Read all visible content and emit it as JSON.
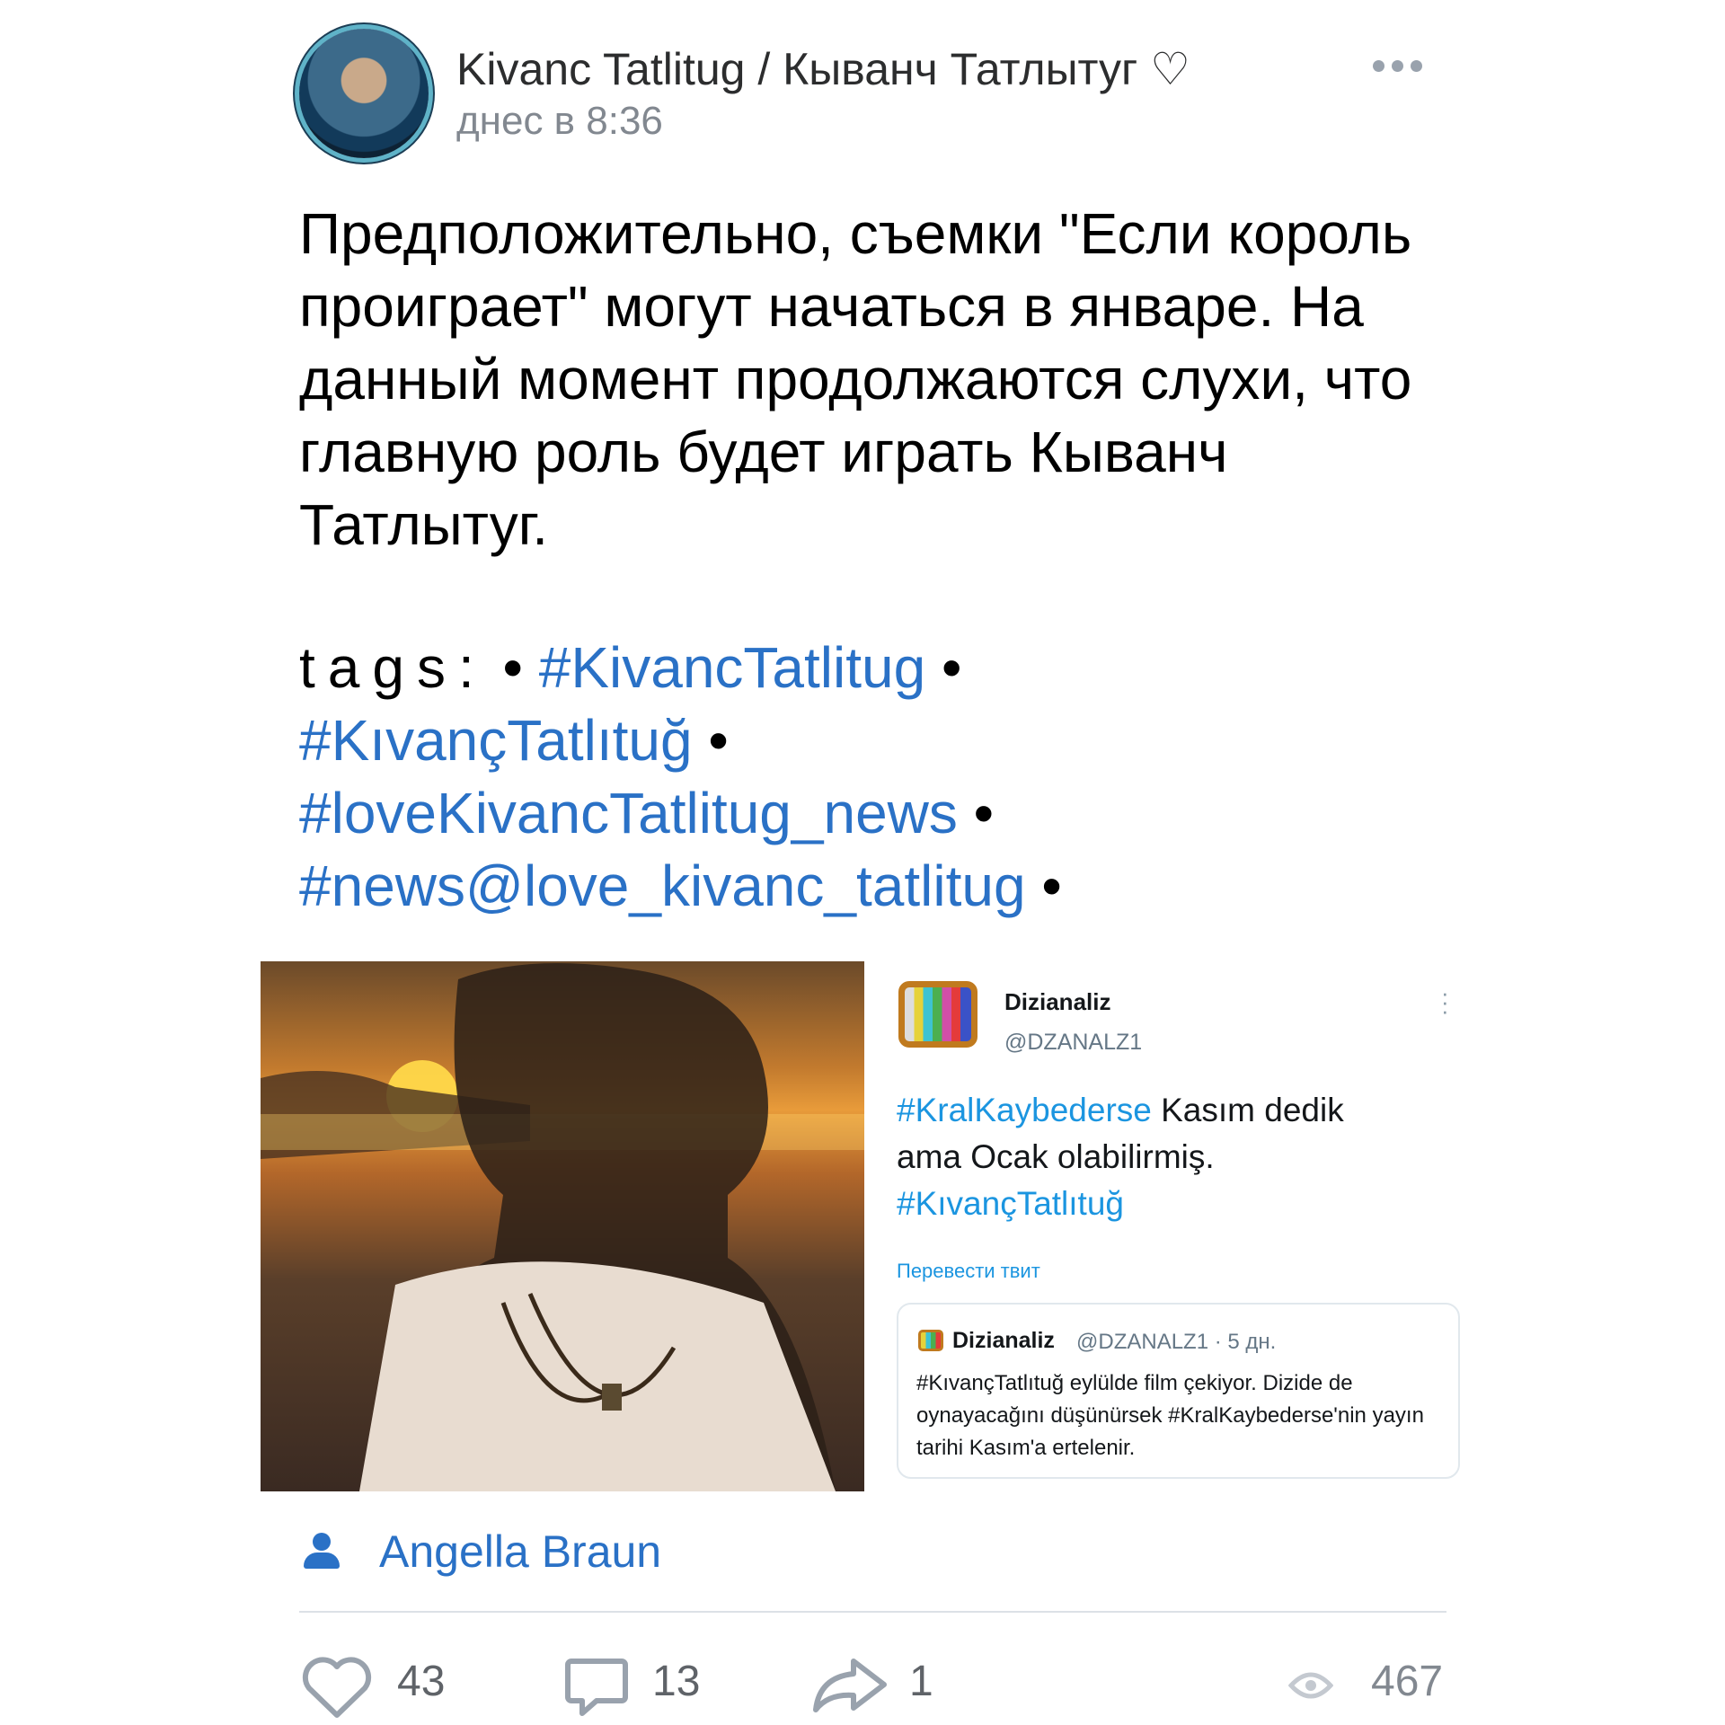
{
  "post": {
    "author": "Kivanc Tatlitug / Кыванч Татлытуг ♡",
    "time": "днес в 8:36",
    "text": "Предположительно, съемки \"Если король проиграет\" могут начаться в январе. На данный момент продолжаются слухи, что главную роль будет играть Кыванч Татлытуг.",
    "tags_label": "tags:",
    "tags": [
      "#KivancTatlitug",
      "#KıvançTatlıtuğ",
      "#loveKivancTatlitug_news",
      "#news@love_kivanc_tatlitug"
    ],
    "bullet": "•"
  },
  "tweet": {
    "name": "Dizianaliz",
    "handle": "@DZANALZ1",
    "hashtag1": "#KralKaybederse",
    "text_mid": " Kasım dedik ama Ocak olabilirmiş.",
    "hashtag2": "#KıvançTatlıtuğ",
    "translate": "Перевести твит",
    "quote": {
      "name": "Dizianaliz",
      "meta": "@DZANALZ1 · 5 дн.",
      "text": "#KıvançTatlıtuğ eylülde film çekiyor. Dizide de oynayacağını düşünürsek #KralKaybederse'nin yayın tarihi Kasım'a ertelenir."
    }
  },
  "credit": {
    "name": "Angella Braun"
  },
  "footer": {
    "likes": "43",
    "comments": "13",
    "shares": "1",
    "views": "467"
  },
  "icons": [
    "more-icon",
    "avatar",
    "person-icon",
    "heart-icon",
    "comment-icon",
    "share-icon",
    "eye-icon",
    "tv-icon"
  ],
  "colors": {
    "link": "#2a71c6",
    "muted": "#828890",
    "twitter_blue": "#1b95e0"
  }
}
